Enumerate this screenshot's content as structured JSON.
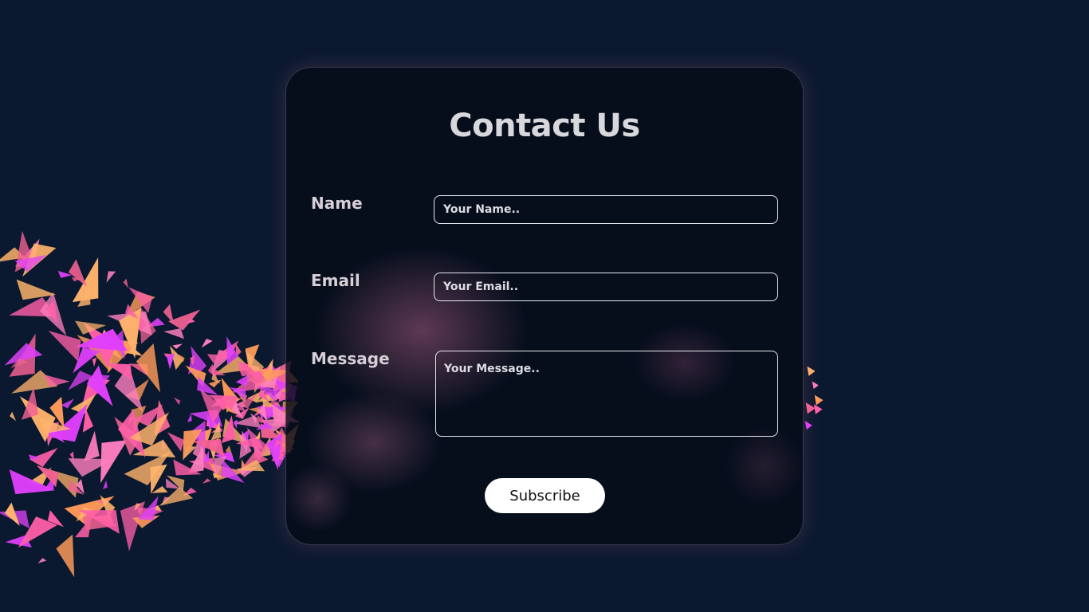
{
  "form": {
    "title": "Contact Us",
    "name_label": "Name",
    "name_placeholder": "Your Name..",
    "email_label": "Email",
    "email_placeholder": "Your Email..",
    "message_label": "Message",
    "message_placeholder": "Your Message..",
    "submit_label": "Subscribe"
  },
  "colors": {
    "background": "#0b1930",
    "card": "#050c18",
    "shard_pink": "#ff5fa8",
    "shard_orange": "#ff9a5a",
    "shard_magenta": "#e040fb",
    "text_light": "#d8d8dc",
    "button_bg": "#ffffff"
  }
}
